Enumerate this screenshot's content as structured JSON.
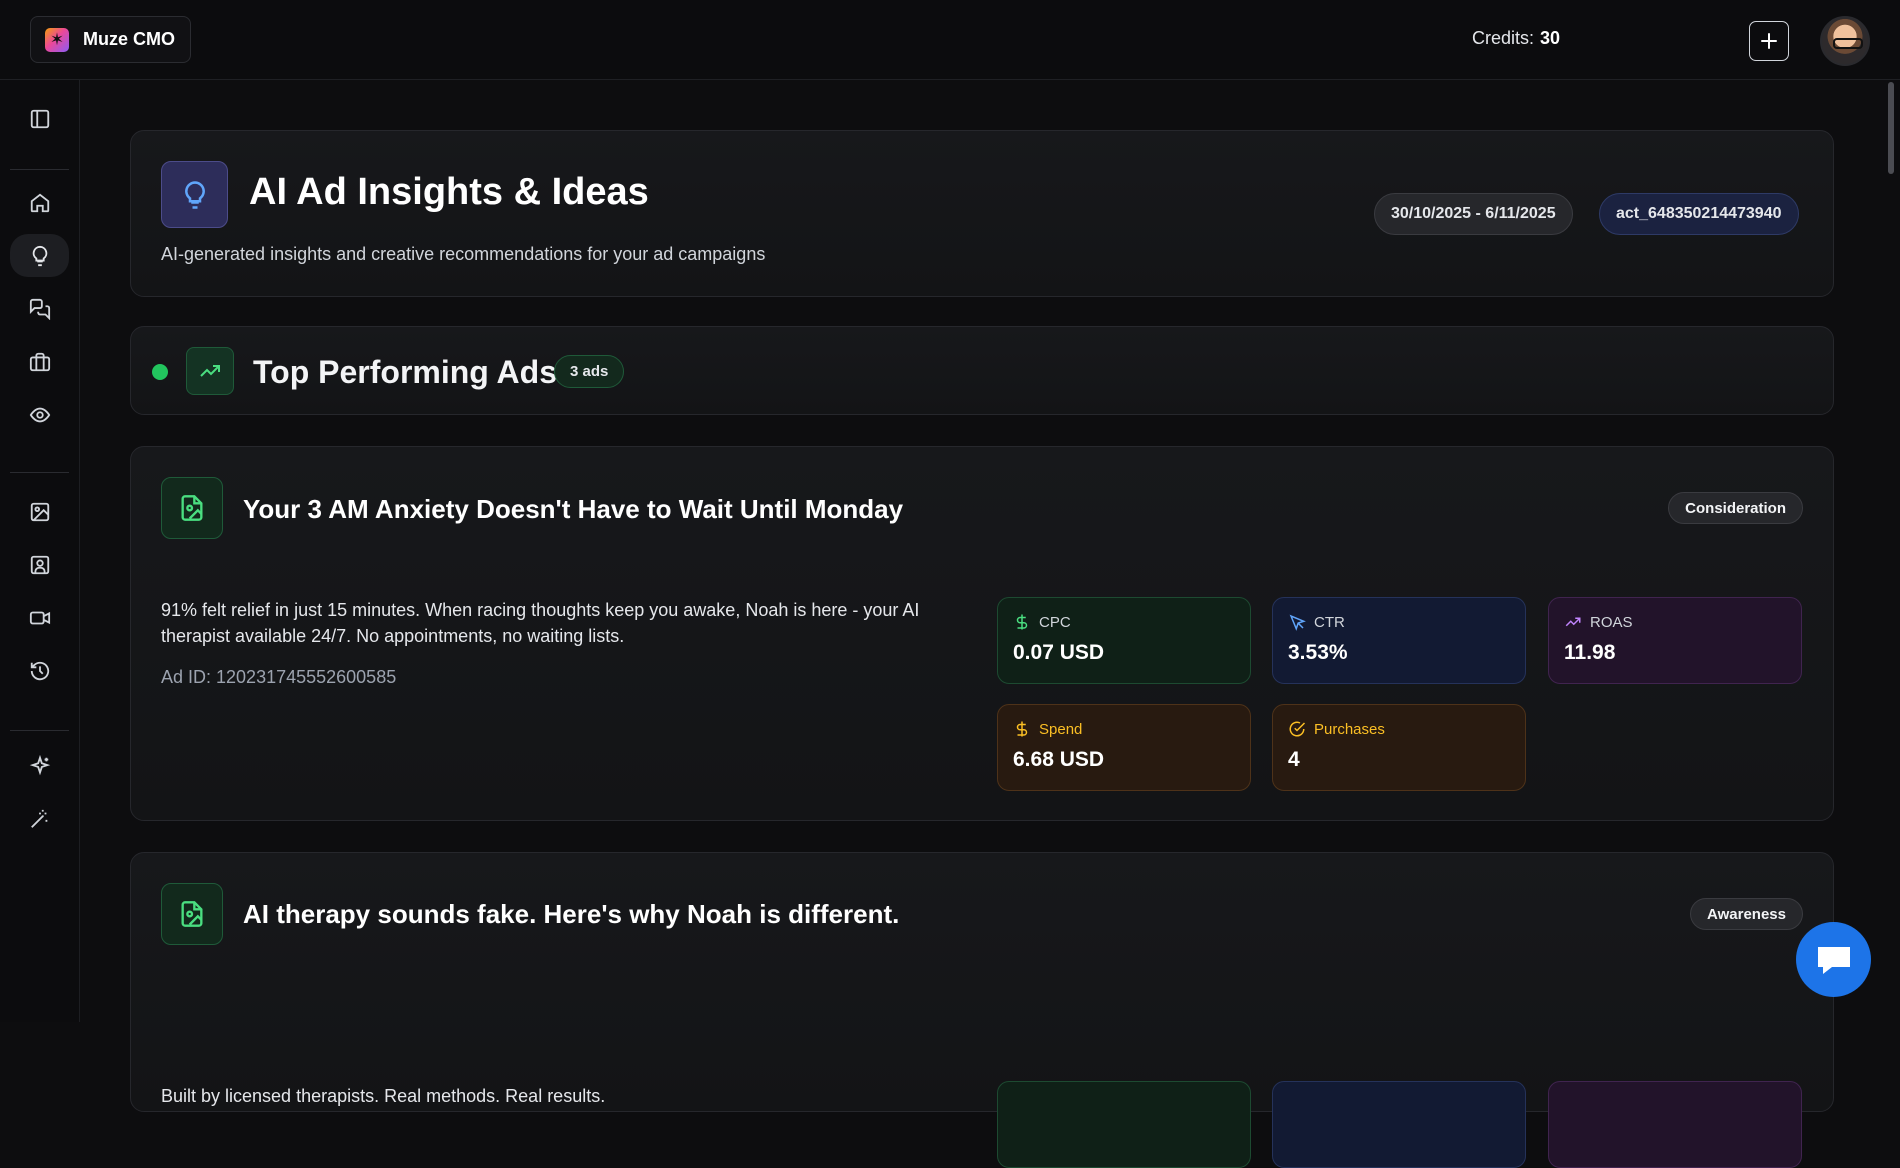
{
  "app": {
    "name": "Muze CMO"
  },
  "topbar": {
    "credits_label": "Credits:",
    "credits_value": "30"
  },
  "sidebar": {
    "items": [
      {
        "name": "toggle-sidebar",
        "icon": "panel-icon"
      },
      {
        "name": "home",
        "icon": "home-icon"
      },
      {
        "name": "insights",
        "icon": "lightbulb-icon",
        "active": true
      },
      {
        "name": "chat",
        "icon": "messages-icon"
      },
      {
        "name": "briefcase",
        "icon": "briefcase-icon"
      },
      {
        "name": "monitor",
        "icon": "eye-icon"
      },
      {
        "name": "images",
        "icon": "image-icon"
      },
      {
        "name": "contacts",
        "icon": "user-square-icon"
      },
      {
        "name": "video",
        "icon": "video-icon"
      },
      {
        "name": "history",
        "icon": "history-icon"
      },
      {
        "name": "ai-sparkles",
        "icon": "sparkles-icon"
      },
      {
        "name": "magic-wand",
        "icon": "wand-icon"
      }
    ]
  },
  "header": {
    "title": "AI Ad Insights & Ideas",
    "subtitle": "AI-generated insights and creative recommendations for your ad campaigns",
    "date_range": "30/10/2025 - 6/11/2025",
    "account_id": "act_648350214473940"
  },
  "section": {
    "title": "Top Performing Ads",
    "count_badge": "3 ads"
  },
  "ads": [
    {
      "title": "Your 3 AM Anxiety Doesn't Have to Wait Until Monday",
      "stage": "Consideration",
      "body": "91% felt relief in just 15 minutes. When racing thoughts keep you awake, Noah is here - your AI therapist available 24/7. No appointments, no waiting lists.",
      "ad_id": "Ad ID: 120231745552600585",
      "metrics": {
        "cpc": {
          "label": "CPC",
          "value": "0.07 USD"
        },
        "ctr": {
          "label": "CTR",
          "value": "3.53%"
        },
        "roas": {
          "label": "ROAS",
          "value": "11.98"
        },
        "spend": {
          "label": "Spend",
          "value": "6.68 USD"
        },
        "purchases": {
          "label": "Purchases",
          "value": "4"
        }
      }
    },
    {
      "title": "AI therapy sounds fake. Here's why Noah is different.",
      "stage": "Awareness",
      "body": "Built by licensed therapists. Real methods. Real results."
    }
  ],
  "colors": {
    "background": "#0d0d0f",
    "accent_green": "#22c55e",
    "accent_blue": "#60a5fa",
    "accent_purple": "#c084fc",
    "accent_orange": "#fbbf24",
    "chat_button": "#1d74e8"
  }
}
